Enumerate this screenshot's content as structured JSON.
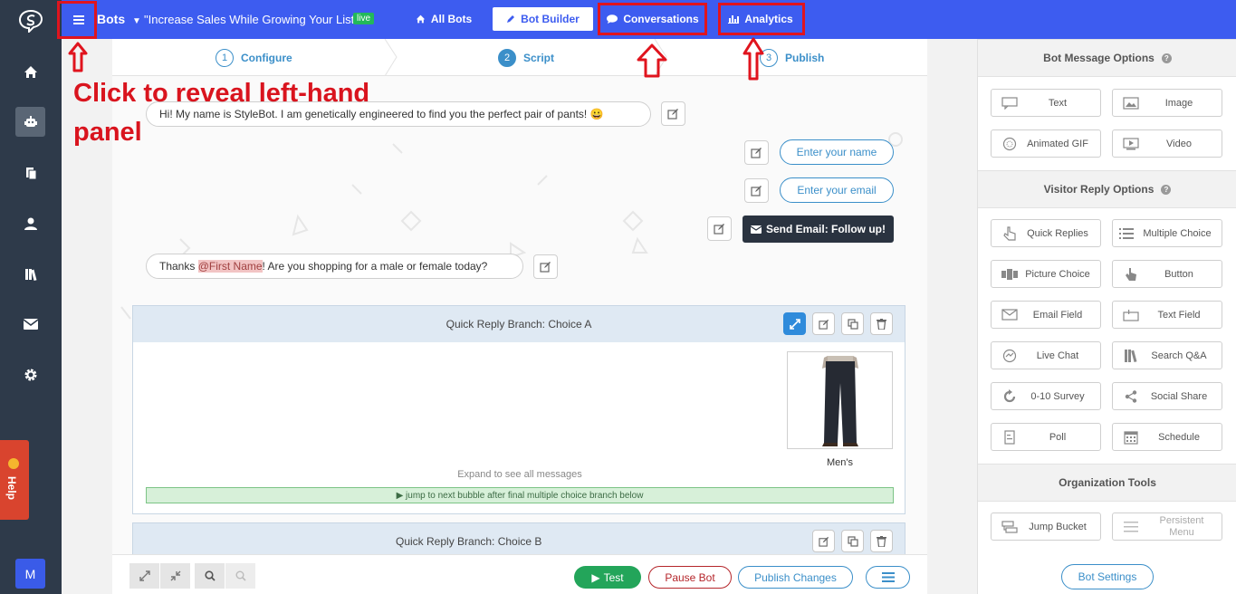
{
  "sidebar": {
    "items": [
      "home-icon",
      "bot-icon",
      "clipboard-icon",
      "user-icon",
      "library-icon",
      "mail-icon",
      "gear-icon"
    ],
    "help_label": "Help",
    "account_initial": "M"
  },
  "topbar": {
    "bots_label": "Bots",
    "bot_name": "\"Increase Sales While Growing Your List\"",
    "status_badge": "live",
    "all_bots": "All Bots",
    "bot_builder": "Bot Builder",
    "conversations": "Conversations",
    "analytics": "Analytics"
  },
  "steps": [
    {
      "num": "1",
      "label": "Configure"
    },
    {
      "num": "2",
      "label": "Script"
    },
    {
      "num": "3",
      "label": "Publish"
    }
  ],
  "script": {
    "greeting": "Hi! My name is StyleBot. I am genetically engineered to find you the perfect pair of pants! 😀",
    "name_input": "Enter your name",
    "email_input": "Enter your email",
    "send_email": "Send Email: Follow up!",
    "question_prefix": "Thanks ",
    "question_mention": "@First Name",
    "question_suffix": "! Are you shopping for a male or female today?",
    "branch_a_title": "Quick Reply Branch: Choice A",
    "product_label": "Men's",
    "expand_text": "Expand to see all messages",
    "jump_text": "▶ jump to next bubble after final multiple choice branch below",
    "branch_b_title": "Quick Reply Branch: Choice B"
  },
  "bottombar": {
    "test": "Test",
    "pause": "Pause Bot",
    "publish": "Publish Changes"
  },
  "right_panel": {
    "bot_message_header": "Bot Message Options",
    "bot_message_options": [
      "Text",
      "Image",
      "Animated GIF",
      "Video"
    ],
    "visitor_reply_header": "Visitor Reply Options",
    "visitor_reply_options": [
      "Quick Replies",
      "Multiple Choice",
      "Picture Choice",
      "Button",
      "Email Field",
      "Text Field",
      "Live Chat",
      "Search Q&A",
      "0-10 Survey",
      "Social Share",
      "Poll",
      "Schedule"
    ],
    "org_header": "Organization Tools",
    "org_options": [
      "Jump Bucket",
      "Persistent Menu"
    ],
    "bot_settings": "Bot Settings"
  },
  "annotation": {
    "text": "Click to reveal left-hand panel"
  },
  "colors": {
    "topbar": "#3d5cf0",
    "sidebar": "#2e3a4a",
    "annotation_red": "#e0141e",
    "accent_blue": "#3b8fc9",
    "test_green": "#23a55a"
  }
}
